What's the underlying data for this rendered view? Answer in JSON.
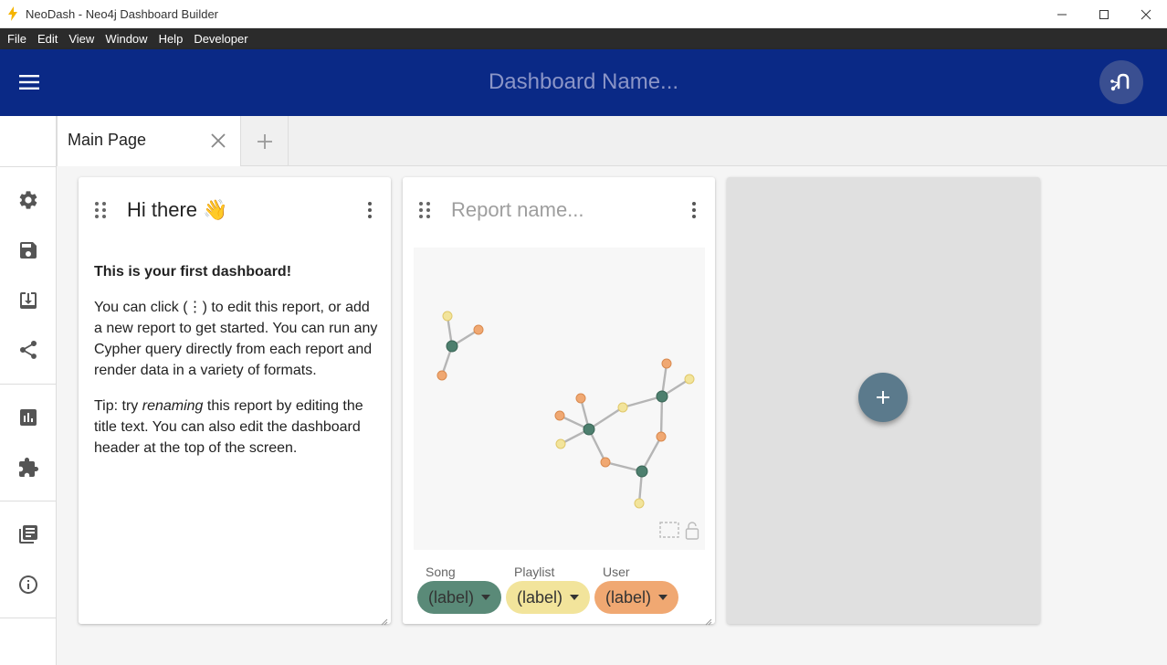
{
  "window": {
    "title": "NeoDash - Neo4j Dashboard Builder",
    "icons": {
      "app": "lightning-icon",
      "minimize": "minimize-icon",
      "maximize": "maximize-icon",
      "close": "close-icon"
    }
  },
  "menu": {
    "items": [
      {
        "label": "File"
      },
      {
        "label": "Edit"
      },
      {
        "label": "View"
      },
      {
        "label": "Window"
      },
      {
        "label": "Help"
      },
      {
        "label": "Developer"
      }
    ]
  },
  "header": {
    "dashboard_name_placeholder": "Dashboard Name...",
    "menu_icon": "hamburger-icon",
    "connection_icon": "neo4j-connection-icon",
    "colors": {
      "background": "#0a2986",
      "placeholder": "#8b95c7"
    }
  },
  "tabs": [
    {
      "label": "Main Page",
      "active": true
    }
  ],
  "sidebar": {
    "items": [
      {
        "icon": "gear-icon",
        "name": "settings"
      },
      {
        "icon": "save-icon",
        "name": "save"
      },
      {
        "icon": "load-icon",
        "name": "load"
      },
      {
        "icon": "share-icon",
        "name": "share"
      },
      {
        "icon": "bar-chart-icon",
        "name": "report-types"
      },
      {
        "icon": "puzzle-icon",
        "name": "extensions"
      },
      {
        "icon": "document-icon",
        "name": "documentation"
      },
      {
        "icon": "info-icon",
        "name": "about"
      }
    ]
  },
  "cards": {
    "text_card": {
      "title": "Hi there 👋",
      "heading": "This is your first dashboard!",
      "paragraph1": "You can click (⋮) to edit this report, or add a new report to get started. You can run any Cypher query directly from each report and render data in a variety of formats.",
      "tip_prefix": "Tip: try ",
      "tip_emphasis": "renaming",
      "tip_suffix": " this report by editing the title text. You can also edit the dashboard header at the top of the screen."
    },
    "graph_card": {
      "title_placeholder": "Report name...",
      "legend": [
        {
          "category": "Song",
          "value": "(label)",
          "color": "#5a8a78"
        },
        {
          "category": "Playlist",
          "value": "(label)",
          "color": "#f2e49b"
        },
        {
          "category": "User",
          "value": "(label)",
          "color": "#f0a872"
        }
      ],
      "graph_colors": {
        "song": "#4d7f6e",
        "playlist": "#f2e49b",
        "user": "#f0a872",
        "edge": "#b5b5b5"
      }
    },
    "add_card": {
      "button_icon": "plus-icon",
      "color": "#5b7a8c"
    }
  }
}
